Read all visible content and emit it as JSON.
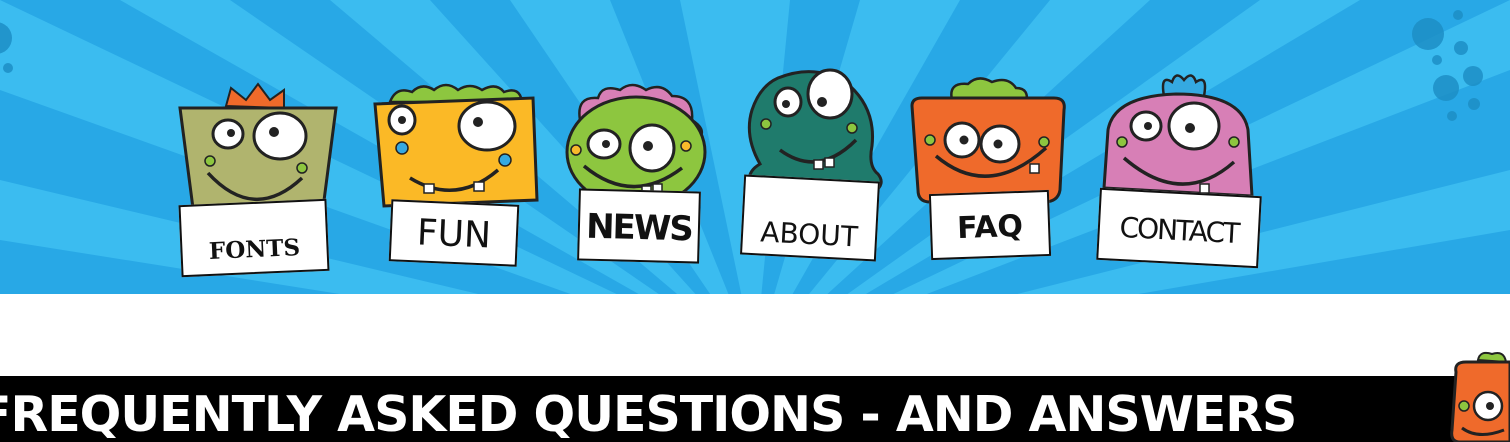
{
  "colors": {
    "sky": "#36b9ee",
    "ray": "#25a6e4",
    "banner_bg": "#000000",
    "banner_text": "#ffffff"
  },
  "nav": {
    "items": [
      {
        "label": "FONTS",
        "monster": "olive-crown-monster-icon",
        "body_color": "#b0b46e"
      },
      {
        "label": "FUN",
        "monster": "yellow-hair-monster-icon",
        "body_color": "#fbb926"
      },
      {
        "label": "NEWS",
        "monster": "green-pink-hair-monster-icon",
        "body_color": "#8dc63f"
      },
      {
        "label": "ABOUT",
        "monster": "teal-blob-monster-icon",
        "body_color": "#1f7b6c"
      },
      {
        "label": "FAQ",
        "monster": "orange-green-hair-monster-icon",
        "body_color": "#ef6a2b"
      },
      {
        "label": "CONTACT",
        "monster": "pink-monster-icon",
        "body_color": "#d77fb6"
      }
    ]
  },
  "banner": {
    "title": "FREQUENTLY ASKED QUESTIONS - AND ANSWERS"
  }
}
